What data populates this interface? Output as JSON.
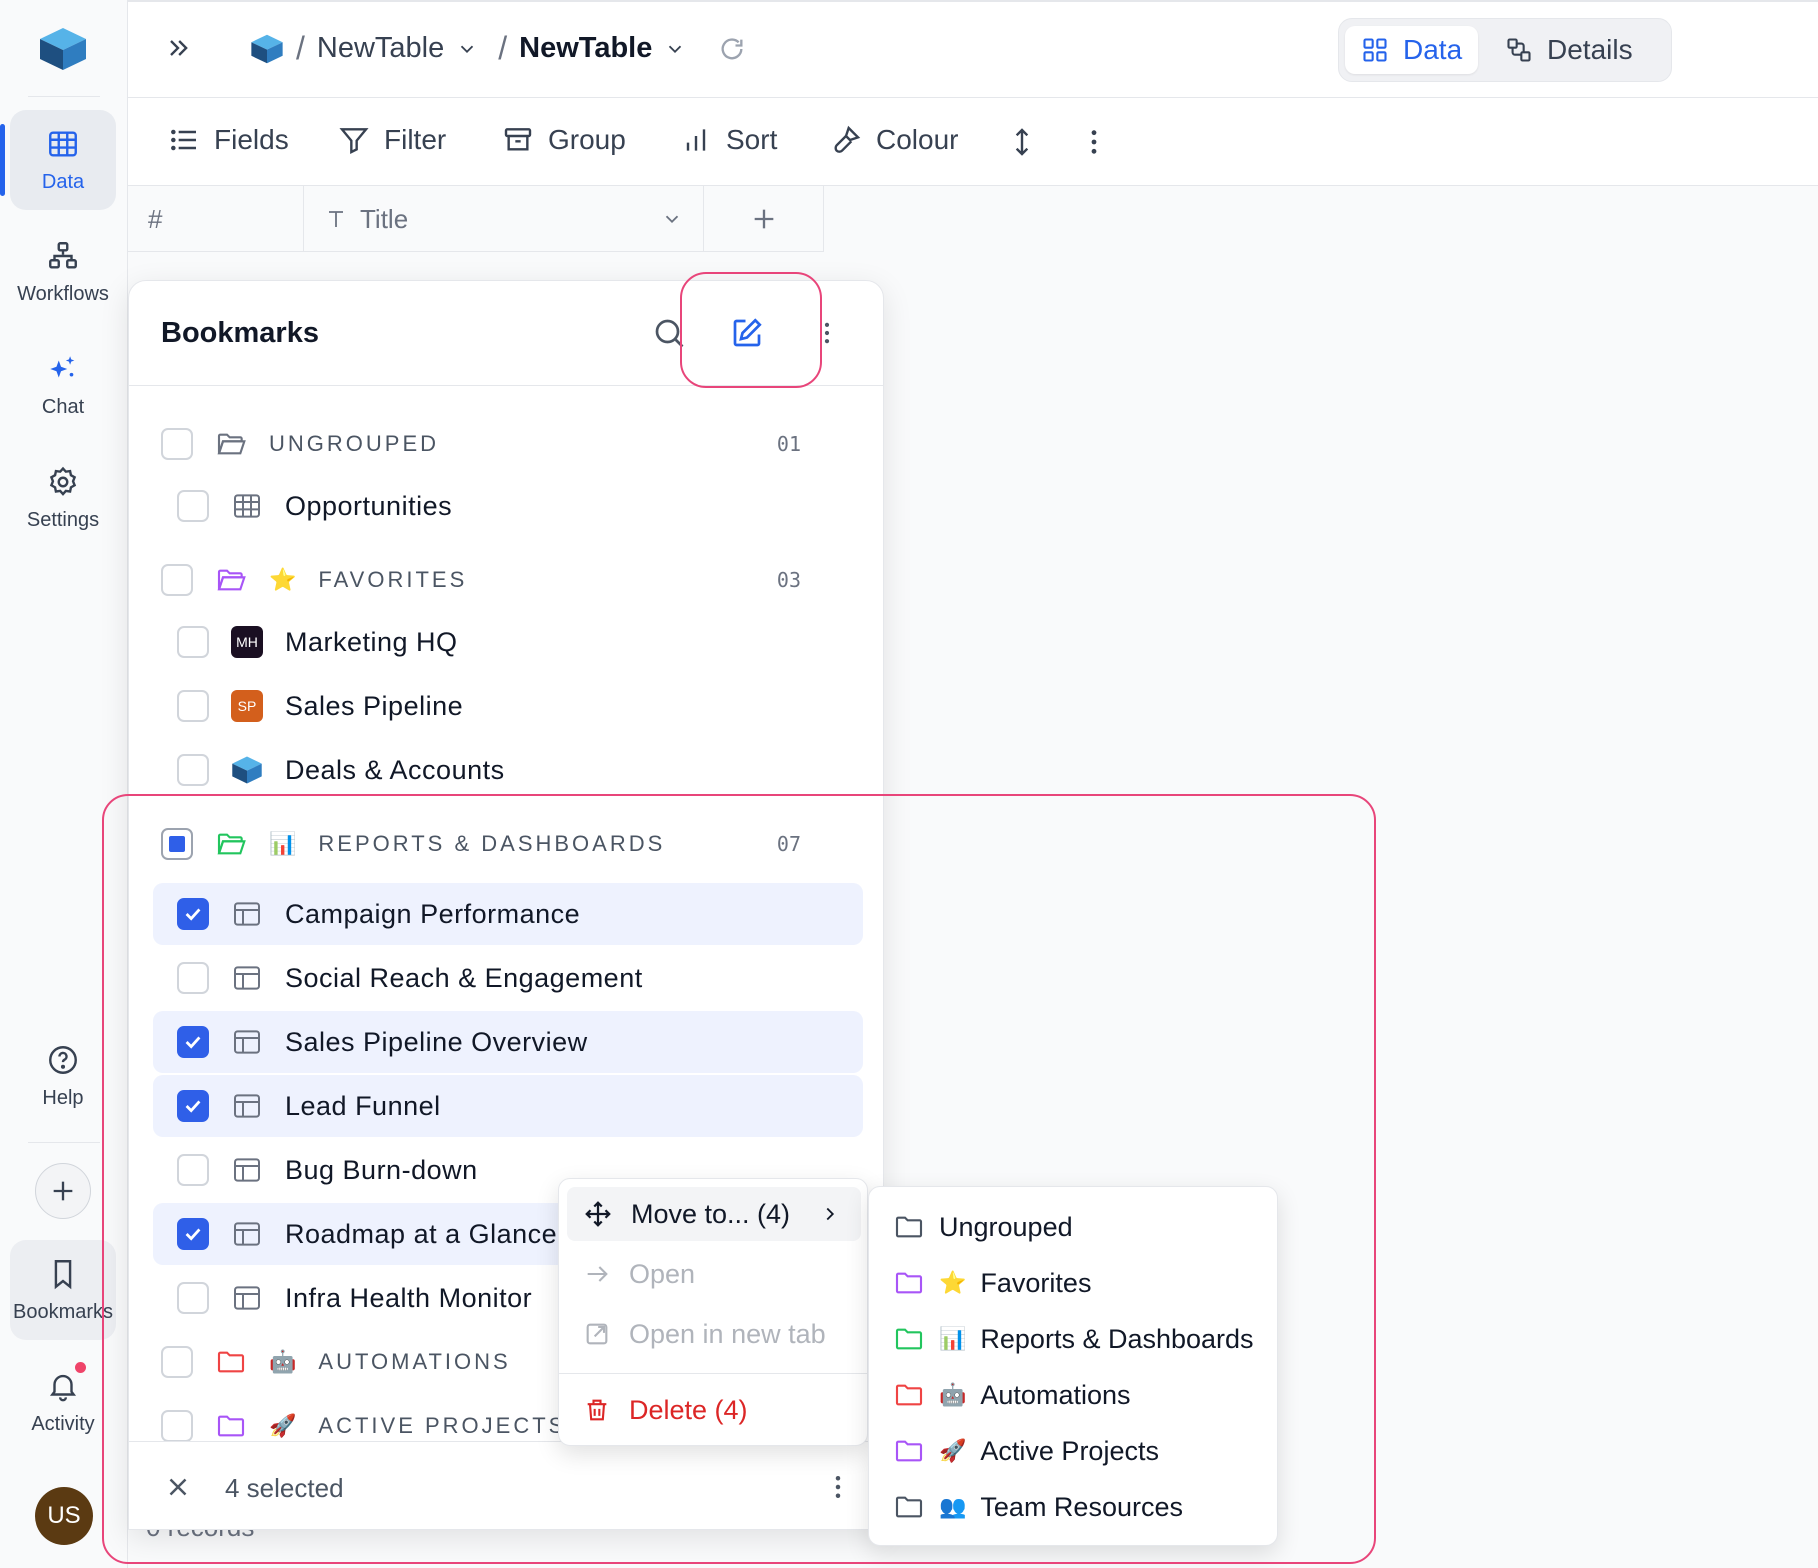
{
  "rail": {
    "items": [
      {
        "label": "Data"
      },
      {
        "label": "Workflows"
      },
      {
        "label": "Chat"
      },
      {
        "label": "Settings"
      },
      {
        "label": "Help"
      },
      {
        "label": "Bookmarks"
      },
      {
        "label": "Activity"
      }
    ],
    "avatar": "US"
  },
  "breadcrumb": {
    "base": "NewTable",
    "table": "NewTable"
  },
  "view_toggle": {
    "data": "Data",
    "details": "Details"
  },
  "toolbar": {
    "fields": "Fields",
    "filter": "Filter",
    "group": "Group",
    "sort": "Sort",
    "colour": "Colour"
  },
  "grid": {
    "index_header": "#",
    "title_header": "Title",
    "records": "0 records"
  },
  "bookmarks": {
    "title": "Bookmarks",
    "groups": {
      "ungrouped": {
        "label": "UNGROUPED",
        "count": "01"
      },
      "favorites": {
        "label": "FAVORITES",
        "count": "03",
        "emoji": "⭐"
      },
      "reports": {
        "label": "REPORTS & DASHBOARDS",
        "count": "07",
        "emoji": "📊"
      },
      "automations": {
        "label": "AUTOMATIONS",
        "emoji": "🤖"
      },
      "active": {
        "label": "ACTIVE PROJECTS",
        "emoji": "🚀"
      }
    },
    "items": {
      "opportunities": "Opportunities",
      "marketing": "Marketing HQ",
      "marketing_badge": "MH",
      "sales": "Sales Pipeline",
      "sales_badge": "SP",
      "deals": "Deals & Accounts",
      "campaign": "Campaign Performance",
      "social": "Social Reach & Engagement",
      "sales_overview": "Sales Pipeline Overview",
      "lead": "Lead Funnel",
      "bug": "Bug Burn-down",
      "roadmap": "Roadmap at a Glance",
      "infra": "Infra Health Monitor"
    },
    "footer": "4 selected"
  },
  "context_menu": {
    "move": "Move to... (4)",
    "open": "Open",
    "open_new_tab": "Open in new tab",
    "delete": "Delete (4)"
  },
  "submenu": {
    "ungrouped": "Ungrouped",
    "favorites": "Favorites",
    "favorites_emoji": "⭐",
    "reports": "Reports & Dashboards",
    "reports_emoji": "📊",
    "automations": "Automations",
    "automations_emoji": "🤖",
    "active": "Active Projects",
    "active_emoji": "🚀",
    "team": "Team Resources",
    "team_emoji": "👥"
  },
  "colors": {
    "accent": "#2563eb",
    "checkbox": "#2f5fe8",
    "selected_row": "#eef2fe",
    "danger": "#dc2626",
    "annotation": "#e8457a",
    "folder_purple": "#a855f7",
    "folder_green": "#22c55e",
    "folder_red": "#ef4444"
  }
}
